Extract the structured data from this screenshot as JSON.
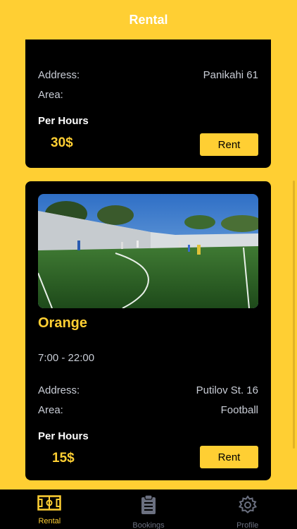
{
  "header": {
    "title": "Rental"
  },
  "cards": [
    {
      "address_label": "Address:",
      "address_value": "Panikahi 61",
      "area_label": "Area:",
      "area_value": "",
      "per_hours_label": "Per Hours",
      "price": "30$",
      "rent_label": "Rent"
    },
    {
      "name": "Orange",
      "hours": "7:00 - 22:00",
      "address_label": "Address:",
      "address_value": "Putilov St. 16",
      "area_label": "Area:",
      "area_value": "Football",
      "per_hours_label": "Per Hours",
      "price": "15$",
      "rent_label": "Rent",
      "photo_icon": "football-field-photo"
    }
  ],
  "tabs": [
    {
      "label": "Rental",
      "icon": "pitch-icon",
      "active": true
    },
    {
      "label": "Bookings",
      "icon": "clipboard-icon",
      "active": false
    },
    {
      "label": "Profile",
      "icon": "gear-icon",
      "active": false
    }
  ],
  "colors": {
    "accent": "#FFCF33",
    "card": "#000000",
    "muted": "#c9cdd6",
    "inactive_tab": "#6b7080"
  }
}
